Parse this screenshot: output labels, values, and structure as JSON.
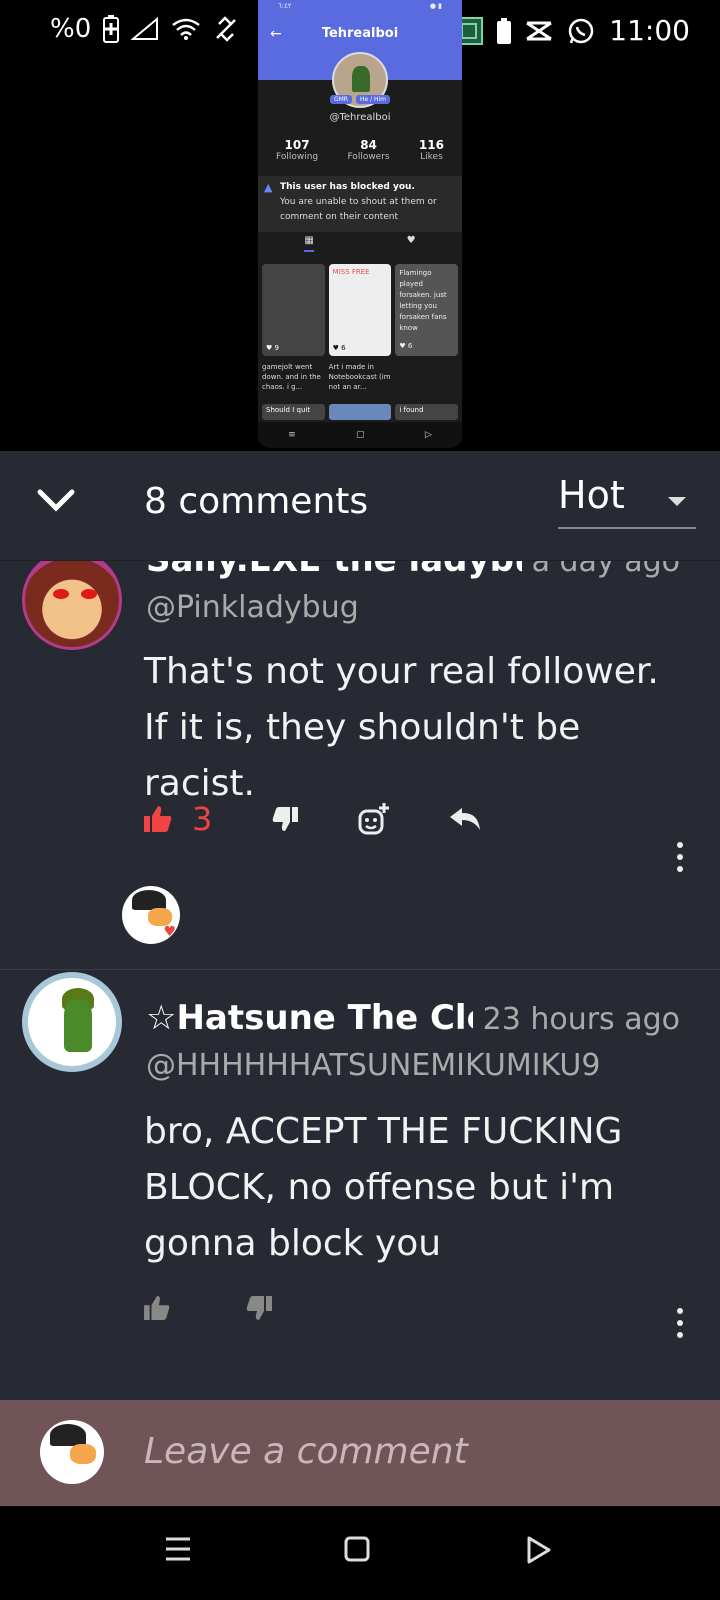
{
  "status_bar": {
    "battery_percent": "%0",
    "time": "11:00",
    "icons": [
      "battery-charging-icon",
      "signal-icon",
      "wifi-icon",
      "data-off-icon",
      "dot-icon",
      "app-icon",
      "battery-icon",
      "capcut-icon",
      "whatsapp-icon"
    ]
  },
  "embedded_screenshot": {
    "status_time": "٦:٤٢",
    "title": "Tehrealboi",
    "badges": [
      "GMR",
      "He / Him"
    ],
    "handle": "@Tehrealboi",
    "stats": [
      {
        "num": "107",
        "label": "Following"
      },
      {
        "num": "84",
        "label": "Followers"
      },
      {
        "num": "116",
        "label": "Likes"
      }
    ],
    "blocked_title": "This user has blocked you.",
    "blocked_body": "You are unable to shout at them or comment on their content",
    "tiles": [
      {
        "likes": "♥ 9",
        "text": ""
      },
      {
        "likes": "♥ 6",
        "text": "MISS FREE"
      },
      {
        "likes": "♥ 6",
        "text": "Flamingo played forsaken. just letting you forsaken fans know"
      }
    ],
    "captions": [
      "gamejolt went down. and in the chaos. i g...",
      "Art i made in Notebookcast (im not an ar...",
      ""
    ],
    "row2": [
      "Should I quit",
      "",
      "i found"
    ]
  },
  "comments_header": {
    "count_label": "8 comments",
    "sort_value": "Hot"
  },
  "comments": [
    {
      "name": "Sally.EXE the ladybug",
      "time": "a day ago",
      "handle": "@Pinkladybug",
      "text": "That's not your real follower. If it is, they shouldn't be racist.",
      "like_count": "3"
    },
    {
      "name": "☆Hatsune The Clown",
      "time": "23 hours ago",
      "handle": "@HHHHHHATSUNEMIKUMIKU9",
      "text": "bro, ACCEPT THE FUCKING BLOCK, no offense but i'm gonna block you",
      "like_count": ""
    }
  ],
  "input": {
    "placeholder": "Leave a comment"
  },
  "colors": {
    "panel_bg": "#272a33",
    "like_active": "#ef4444",
    "input_bar_bg": "#705457"
  }
}
